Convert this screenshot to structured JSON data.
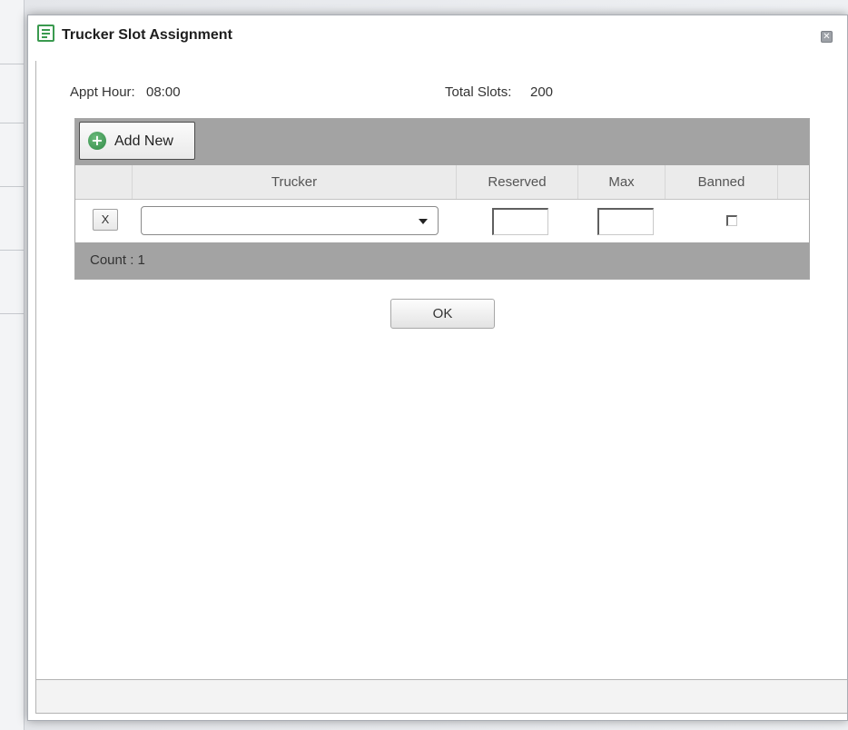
{
  "dialog": {
    "title": "Trucker Slot Assignment",
    "close_label": "✕"
  },
  "info": {
    "appt_hour_label": "Appt Hour:",
    "appt_hour_value": "08:00",
    "total_slots_label": "Total Slots:",
    "total_slots_value": "200"
  },
  "grid": {
    "add_new_label": "Add New",
    "columns": [
      "",
      "Trucker",
      "Reserved",
      "Max",
      "Banned"
    ],
    "rows": [
      {
        "delete_label": "X",
        "trucker": "",
        "reserved": "",
        "max": "",
        "banned": false
      }
    ],
    "count_text": "Count : 1"
  },
  "actions": {
    "ok_label": "OK"
  },
  "colors": {
    "accent_green": "#3a9a4f",
    "grid_bar": "#a3a3a3",
    "header_bg": "#ebebeb"
  }
}
